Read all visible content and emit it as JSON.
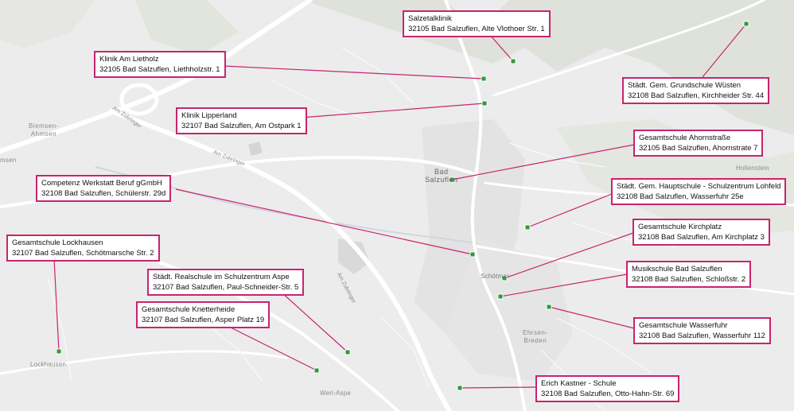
{
  "map": {
    "places": {
      "biemsen": "Biemsen-\nAhmsen",
      "ahmsen_edge": "msen",
      "hollenstein": "Hollenstein",
      "lockhausen": "Lockhausen",
      "werl_aspe": "Werl-Aspe",
      "ehrsen": "Ehrsen-\nBreden",
      "schoetmar": "Schötmar",
      "bad_salzuflen": "Bad\nSalzuflen"
    },
    "roads": {
      "am_zubringer_1": "Am Zubringer",
      "am_zubringer_2": "Am Zubringer",
      "am_zubringer_3": "Am Zubringer"
    },
    "colors": {
      "marker": "#2f9a3a",
      "leader": "#c8246f",
      "water": "#c9d6df",
      "forest": "#dde0d8"
    }
  },
  "labels": [
    {
      "name": "Salzetalklinik",
      "address": "32105 Bad Salzuflen, Alte Vlothoer Str. 1"
    },
    {
      "name": "Klinik Am Lietholz",
      "address": "32105 Bad Salzuflen, Liethholzstr. 1"
    },
    {
      "name": "Klinik Lipperland",
      "address": "32107 Bad Salzuflen, Am Ostpark 1"
    },
    {
      "name": "Städt. Gem. Grundschule Wüsten",
      "address": "32108 Bad Salzuflen, Kirchheider Str. 44"
    },
    {
      "name": "Gesamtschule Ahornstraße",
      "address": "32105 Bad Salzuflen, Ahornstrate 7"
    },
    {
      "name": "Competenz Werkstatt Beruf gGmbH",
      "address": "32108 Bad Salzuflen, Schülerstr. 29d"
    },
    {
      "name": "Städt. Gem. Hauptschule - Schulzentrum Lohfeld",
      "address": "32108 Bad Salzuflen, Wasserfuhr 25e"
    },
    {
      "name": "Gesamtschule Lockhausen",
      "address": "32107 Bad Salzuflen, Schötmarsche Str. 2"
    },
    {
      "name": "Gesamtschule Kirchplatz",
      "address": "32108 Bad Salzuflen, Am Kirchplatz 3"
    },
    {
      "name": "Städt. Realschule im Schulzentrum Aspe",
      "address": "32107 Bad Salzuflen, Paul-Schneider-Str. 5"
    },
    {
      "name": "Musikschule Bad Salzuflen",
      "address": "32108 Bad Salzuflen, Schloßstr. 2"
    },
    {
      "name": "Gesamtschule Knetterheide",
      "address": "32107 Bad Salzuflen, Asper Platz 19"
    },
    {
      "name": "Gesamtschule Wasserfuhr",
      "address": "32108 Bad Salzuflen, Wasserfuhr 112"
    },
    {
      "name": "Erich Kastner - Schule",
      "address": "32108 Bad Salzuflen, Otto-Hahn-Str. 69"
    }
  ]
}
